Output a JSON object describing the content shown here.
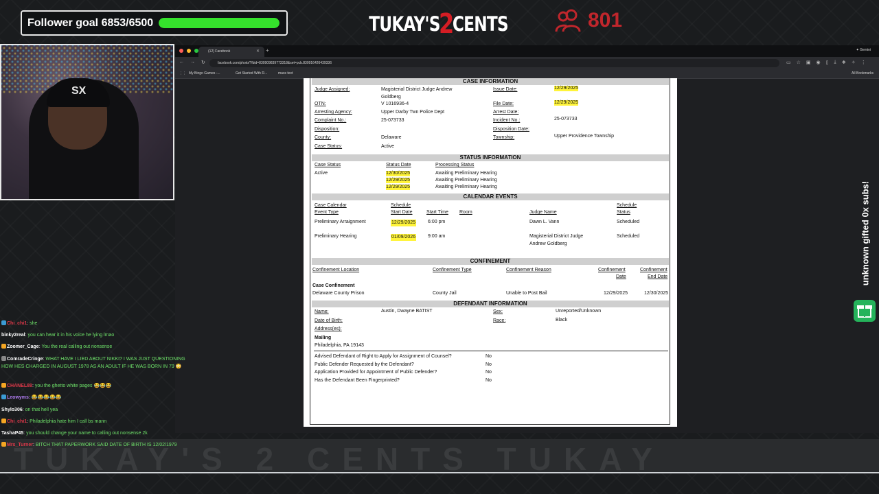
{
  "overlay": {
    "follower_goal_label": "Follower goal 6853/6500",
    "follower_goal_progress": 1.0,
    "logo_part1": "TUKAY'S",
    "logo_two": "2",
    "logo_part2": "CENTS",
    "viewer_count": "801",
    "sub_banner": "unknown gifted 0x subs!",
    "background_band_text": "TUKAY'S 2 CENTS TUKAY",
    "cap_logo": "SX",
    "colors": {
      "goal_fill": "#35e22c",
      "accent_red": "#c0262c",
      "sub_green": "#25b35b"
    }
  },
  "browser": {
    "tab_title": "(12) Facebook",
    "url": "facebook.com/photo/?fbid=830909839773318&set=pcb.830916426439336",
    "bookmarks": [
      "My Bingo Games -...",
      "Get Started With R...",
      "mass text"
    ],
    "all_bookmarks": "All Bookmarks",
    "gemini": "Gemini"
  },
  "document": {
    "case_info": {
      "title": "CASE INFORMATION",
      "rows": [
        {
          "l1": "Judge Assigned:",
          "v1": "Magisterial District Judge Andrew",
          "l2": "Issue Date:",
          "v2": "12/29/2025"
        },
        {
          "l1": "",
          "v1": "Goldberg",
          "l2": "",
          "v2": ""
        },
        {
          "l1": "OTN:",
          "v1": "V 1016936-4",
          "l2": "File Date:",
          "v2": "12/29/2025"
        },
        {
          "l1": "Arresting Agency:",
          "v1": "Upper Darby Twn Police Dept",
          "l2": "Arrest Date:",
          "v2": ""
        },
        {
          "l1": "Complaint No.:",
          "v1": "25-073733",
          "l2": "Incident No.:",
          "v2": "25-073733"
        },
        {
          "l1": "Disposition:",
          "v1": "",
          "l2": "Disposition Date:",
          "v2": ""
        },
        {
          "l1": "County:",
          "v1": "Delaware",
          "l2": "Township:",
          "v2": "Upper Providence Township"
        },
        {
          "l1": "Case Status:",
          "v1": "Active",
          "l2": "",
          "v2": ""
        }
      ]
    },
    "status_info": {
      "title": "STATUS INFORMATION",
      "headers": [
        "Case Status",
        "Status Date",
        "Processing Status"
      ],
      "case_status": "Active",
      "entries": [
        {
          "date": "12/30/2025",
          "status": "Awaiting Preliminary Hearing"
        },
        {
          "date": "12/29/2025",
          "status": "Awaiting Preliminary Hearing"
        },
        {
          "date": "12/29/2025",
          "status": "Awaiting Preliminary Hearing"
        }
      ]
    },
    "calendar": {
      "title": "CALENDAR EVENTS",
      "headers": {
        "event_1": "Case Calendar",
        "event_2": "Event Type",
        "start_1": "Schedule",
        "start_2": "Start Date",
        "time": "Start Time",
        "room": "Room",
        "judge": "Judge Name",
        "status_1": "Schedule",
        "status_2": "Status"
      },
      "events": [
        {
          "type": "Preliminary Arraignment",
          "date": "12/29/2025",
          "time": "6:00 pm",
          "judge_1": "Dawn L. Vann",
          "judge_2": "",
          "status": "Scheduled"
        },
        {
          "type": "Preliminary Hearing",
          "date": "01/09/2026",
          "time": "9:00 am",
          "judge_1": "Magisterial District Judge",
          "judge_2": "Andrew Goldberg",
          "status": "Scheduled"
        }
      ]
    },
    "confinement": {
      "title": "CONFINEMENT",
      "headers": {
        "location": "Confinement Location",
        "type": "Confinement Type",
        "reason": "Confinement Reason",
        "date_1": "Confinement",
        "date_2": "Date",
        "end_1": "Confinement",
        "end_2": "End Date"
      },
      "case_label": "Case Confinement",
      "location": "Delaware County Prison",
      "type": "County Jail",
      "reason": "Unable to Post Bail",
      "date": "12/29/2025",
      "end_date": "12/30/2025"
    },
    "defendant": {
      "title": "DEFENDANT INFORMATION",
      "name_label": "Name:",
      "name": "Austin, Dwayne BATIST",
      "sex_label": "Sex:",
      "sex": "Unreported/Unknown",
      "dob_label": "Date of Birth:",
      "dob": "",
      "race_label": "Race:",
      "race": "Black",
      "address_label": "Address(es):",
      "mailing_label": "Mailing",
      "mailing": "Philadelphia, PA 19143"
    },
    "questions": [
      {
        "q": "Advised Defendant of Right to Apply for Assignment of Counsel?",
        "a": "No"
      },
      {
        "q": "Public Defender Requested by the Defendant?",
        "a": "No"
      },
      {
        "q": "Application Provided for Appointment of Public Defender?",
        "a": "No"
      },
      {
        "q": "Has the Defendant Been Fingerprinted?",
        "a": "No"
      }
    ]
  },
  "chat": [
    {
      "user": "Chi_chi1",
      "color": "#e0394a",
      "badge": "#3b9bd4",
      "text": "she"
    },
    {
      "user": "binky2real",
      "color": "#ffffff",
      "badge": "",
      "text": "you can hear it in his voice he lying lmao"
    },
    {
      "user": "Zoomer_Cage",
      "color": "#ffffff",
      "badge": "#f5a623",
      "text": "You the real calling out nonsense"
    },
    {
      "user": "ComradeCringe",
      "color": "#ffffff",
      "badge": "#888888",
      "text": "WHAT HAVE I LIED ABOUT NIKKI? I WAS JUST QUESTIONING HOW HES CHARGED IN AUGUST 1978 AS AN ADULT IF HE WAS BORN IN 79 😳"
    },
    {
      "user": "CHANEL88",
      "color": "#e0394a",
      "badge": "#f5a623",
      "text": "you the ghetto white pages 😂😂😂"
    },
    {
      "user": "Leowyms",
      "color": "#b07cf0",
      "badge": "#3b9bd4",
      "text": "😂😂😂😂😂"
    },
    {
      "user": "Shylo306",
      "color": "#ffffff",
      "badge": "",
      "text": "on that hell yea"
    },
    {
      "user": "Chi_chi1",
      "color": "#e0394a",
      "badge": "#f5a623",
      "text": "Philadelphia hate him I call bs mann"
    },
    {
      "user": "TashaP45",
      "color": "#ffffff",
      "badge": "",
      "text": "you should change your name to calling out nonsense 2k"
    },
    {
      "user": "Mrs_Turner",
      "color": "#e0394a",
      "badge": "#f5a623",
      "text": "BITCH THAT PAPERWORK SAID DATE OF BIRTH IS 12/02/1979"
    }
  ]
}
